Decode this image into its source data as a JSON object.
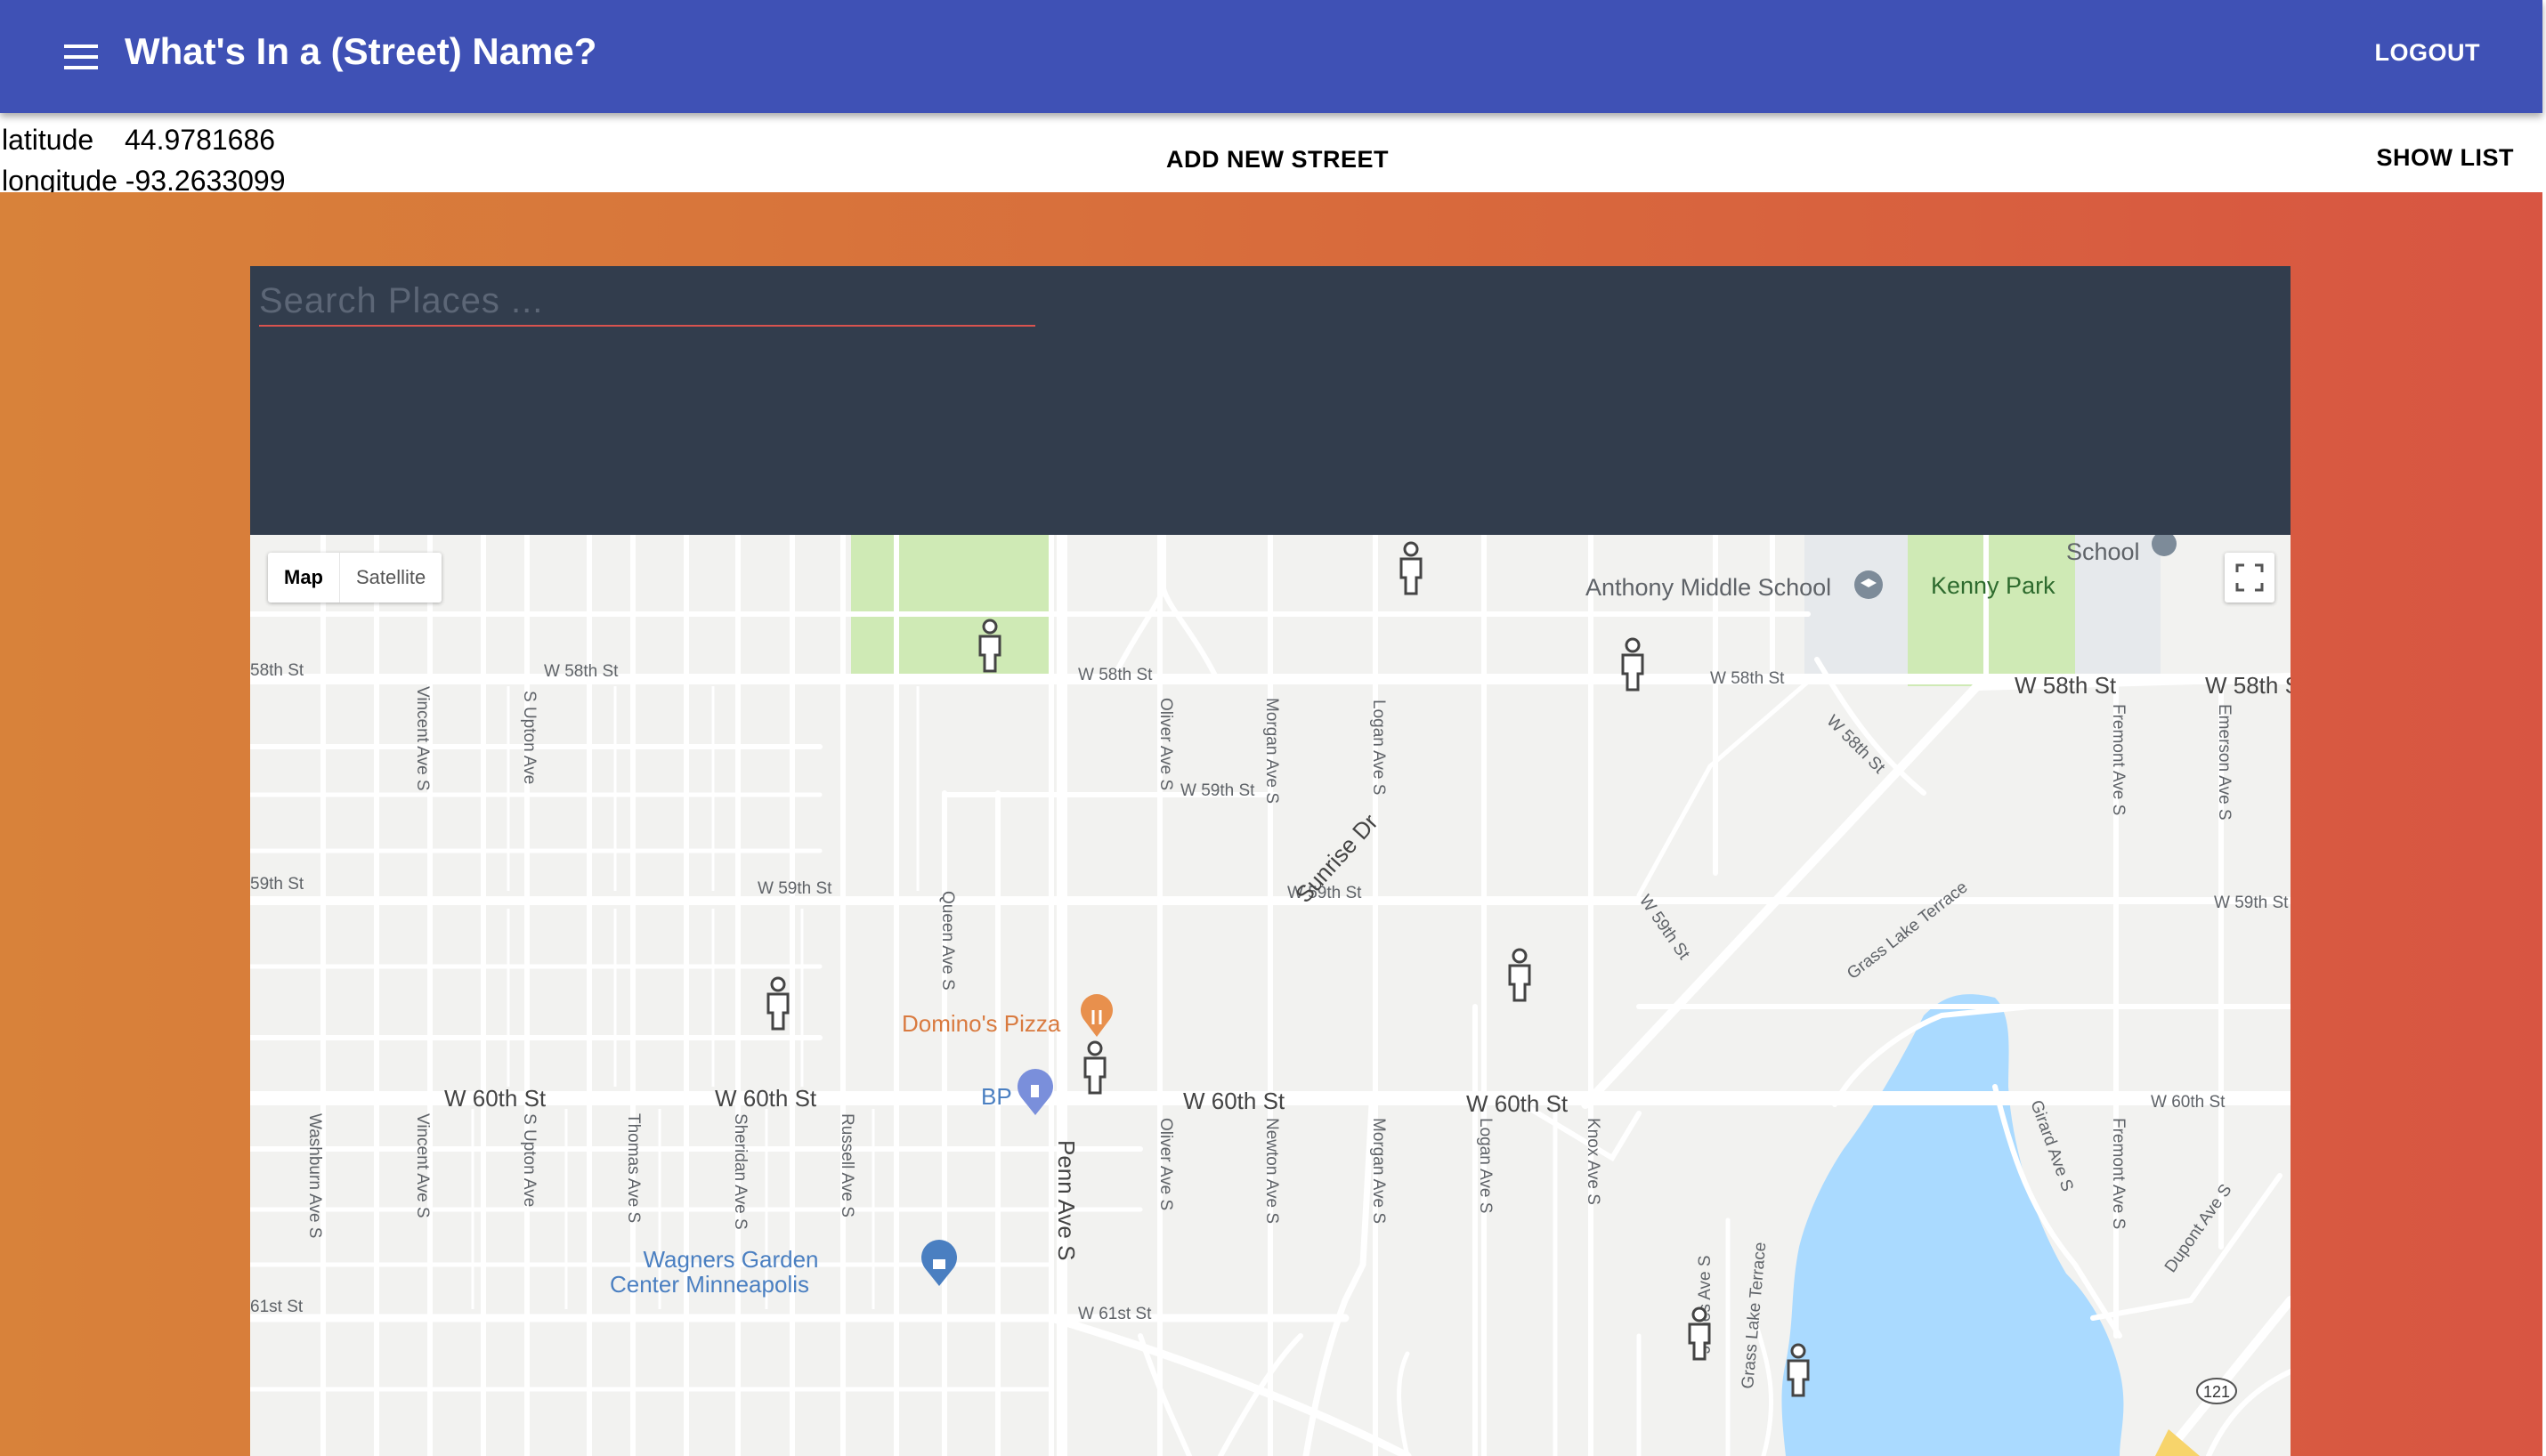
{
  "app": {
    "title": "What's In a (Street) Name?",
    "logout_label": "LOGOUT"
  },
  "location": {
    "latitude_label": "latitude",
    "latitude_value": "44.9781686",
    "longitude_label": "longitude",
    "longitude_value": "-93.2633099"
  },
  "actions": {
    "add_street_label": "ADD NEW STREET",
    "show_list_label": "SHOW LIST"
  },
  "search": {
    "placeholder": "Search Places ..."
  },
  "map": {
    "type_controls": {
      "map_label": "Map",
      "satellite_label": "Satellite",
      "selected": "Map"
    },
    "places": {
      "anthony_middle_school": "Anthony Middle School",
      "kenny_park": "Kenny Park",
      "school": "School",
      "dominos": "Domino's Pizza",
      "bp": "BP",
      "wagners_line1": "Wagners Garden",
      "wagners_line2": "Center Minneapolis",
      "highway_shield": "121"
    },
    "streets": {
      "w58": "W 58th St",
      "w58_edge": "58th St",
      "w59": "W 59th St",
      "w59_edge": "59th St",
      "w60": "W 60th St",
      "w61": "W 61st St",
      "w61_edge": "61st St",
      "vincent": "Vincent Ave S",
      "upton": "S Upton Ave",
      "oliver": "Oliver Ave S",
      "morgan": "Morgan Ave S",
      "logan": "Logan Ave S",
      "fremont": "Fremont Ave S",
      "emerson": "Emerson Ave S",
      "queen": "Queen Ave S",
      "penn": "Penn Ave S",
      "washburn": "Washburn Ave S",
      "thomas": "Thomas Ave S",
      "sheridan": "Sheridan Ave S",
      "russell": "Russell Ave S",
      "newton": "Newton Ave S",
      "knox": "Knox Ave S",
      "james": "James Ave S",
      "girard": "Girard Ave S",
      "dupont": "Dupont Ave S",
      "sunrise": "Sunrise Dr",
      "grass_lake": "Grass Lake Terrace",
      "w58_ne": "W 58th St",
      "w59_ne": "W 59th St"
    },
    "colors": {
      "park": "#cfeab5",
      "water": "#aadaff",
      "road": "#ffffff",
      "land": "#f2f2f0",
      "poi_orange": "#d97a3f",
      "poi_blue": "#4a7fc1"
    }
  }
}
